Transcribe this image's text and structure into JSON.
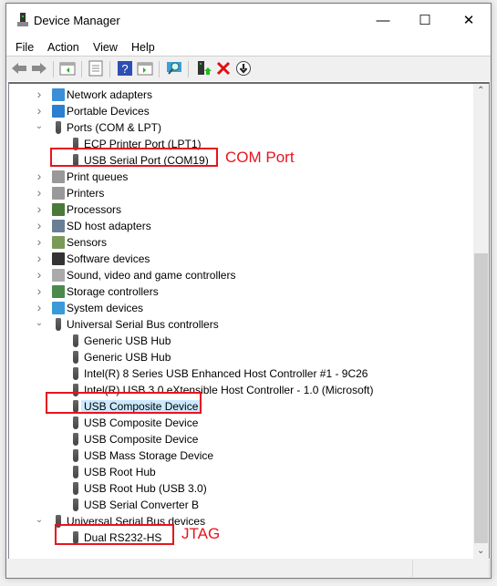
{
  "window": {
    "title": "Device Manager",
    "minimize": "—",
    "maximize": "☐",
    "close": "✕"
  },
  "menu": [
    "File",
    "Action",
    "View",
    "Help"
  ],
  "toolbar": {
    "icons": [
      "back-arrow-icon",
      "forward-arrow-icon",
      "show-hide-console-tree-icon",
      "properties-icon",
      "help-icon",
      "action-pane-icon",
      "scan-hardware-icon",
      "update-driver-icon",
      "uninstall-icon",
      "disable-device-icon"
    ]
  },
  "tree": [
    {
      "label": "Network adapters",
      "level": 0,
      "state": "collapsed",
      "icon": "network-adapter-icon"
    },
    {
      "label": "Portable Devices",
      "level": 0,
      "state": "collapsed",
      "icon": "portable-device-icon"
    },
    {
      "label": "Ports (COM & LPT)",
      "level": 0,
      "state": "expanded",
      "icon": "port-icon"
    },
    {
      "label": "ECP Printer Port (LPT1)",
      "level": 1,
      "icon": "port-icon"
    },
    {
      "label": "USB Serial Port (COM19)",
      "level": 1,
      "icon": "port-icon"
    },
    {
      "label": "Print queues",
      "level": 0,
      "state": "collapsed",
      "icon": "printer-icon"
    },
    {
      "label": "Printers",
      "level": 0,
      "state": "collapsed",
      "icon": "printer-icon"
    },
    {
      "label": "Processors",
      "level": 0,
      "state": "collapsed",
      "icon": "processor-icon"
    },
    {
      "label": "SD host adapters",
      "level": 0,
      "state": "collapsed",
      "icon": "sd-host-icon"
    },
    {
      "label": "Sensors",
      "level": 0,
      "state": "collapsed",
      "icon": "sensor-icon"
    },
    {
      "label": "Software devices",
      "level": 0,
      "state": "collapsed",
      "icon": "software-device-icon"
    },
    {
      "label": "Sound, video and game controllers",
      "level": 0,
      "state": "collapsed",
      "icon": "speaker-icon"
    },
    {
      "label": "Storage controllers",
      "level": 0,
      "state": "collapsed",
      "icon": "storage-controller-icon"
    },
    {
      "label": "System devices",
      "level": 0,
      "state": "collapsed",
      "icon": "system-device-icon"
    },
    {
      "label": "Universal Serial Bus controllers",
      "level": 0,
      "state": "expanded",
      "icon": "usb-icon"
    },
    {
      "label": "Generic USB Hub",
      "level": 1,
      "icon": "usb-icon"
    },
    {
      "label": "Generic USB Hub",
      "level": 1,
      "icon": "usb-icon"
    },
    {
      "label": "Intel(R) 8 Series USB Enhanced Host Controller #1 - 9C26",
      "level": 1,
      "icon": "usb-icon"
    },
    {
      "label": "Intel(R) USB 3.0 eXtensible Host Controller - 1.0 (Microsoft)",
      "level": 1,
      "icon": "usb-icon"
    },
    {
      "label": "USB Composite Device",
      "level": 1,
      "icon": "usb-icon",
      "selected": true
    },
    {
      "label": "USB Composite Device",
      "level": 1,
      "icon": "usb-icon"
    },
    {
      "label": "USB Composite Device",
      "level": 1,
      "icon": "usb-icon"
    },
    {
      "label": "USB Mass Storage Device",
      "level": 1,
      "icon": "usb-icon"
    },
    {
      "label": "USB Root Hub",
      "level": 1,
      "icon": "usb-icon"
    },
    {
      "label": "USB Root Hub (USB 3.0)",
      "level": 1,
      "icon": "usb-icon"
    },
    {
      "label": "USB Serial Converter B",
      "level": 1,
      "icon": "usb-icon"
    },
    {
      "label": "Universal Serial Bus devices",
      "level": 0,
      "state": "expanded",
      "icon": "usb-icon"
    },
    {
      "label": "Dual RS232-HS",
      "level": 1,
      "icon": "usb-icon"
    }
  ],
  "annotations": {
    "com": "COM Port",
    "jtag": "JTAG",
    "color": "#e8141e"
  },
  "colors": {
    "selection": "#cce8ff",
    "accent": "#e8141e"
  }
}
